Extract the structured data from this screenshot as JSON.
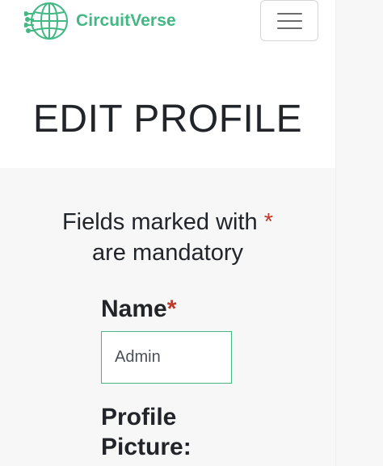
{
  "navbar": {
    "brand_name": "CircuitVerse",
    "brand_color": "#42b883",
    "logo_icon": "circuit-globe-icon",
    "menu_icon": "hamburger-menu-icon"
  },
  "page": {
    "title": "EDIT PROFILE"
  },
  "form": {
    "mandatory_note_prefix": "Fields marked with",
    "mandatory_marker": "*",
    "mandatory_note_suffix": "are mandatory",
    "name_label": "Name",
    "name_required_marker": "*",
    "name_value": "Admin",
    "profile_picture_label": "Profile Picture:"
  },
  "colors": {
    "accent": "#42b883",
    "required": "#c0392b",
    "panel_background": "#f7f7f7"
  }
}
